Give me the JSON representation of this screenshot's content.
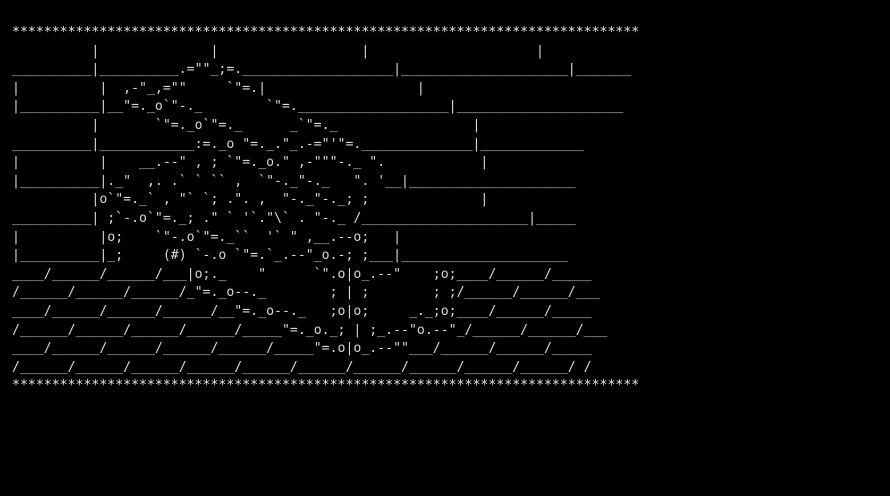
{
  "palette": {
    "background": "#000000",
    "art": "#ffffff",
    "wall_lines": "#e0c25a",
    "border": "#e8e8e8"
  },
  "ascii_art": {
    "top_border": "*******************************************************************************",
    "body": "          |              |                  |                     |\n__________|__________.=\"\"_;=.___________________|_____________________|_______\n|          |  ,-\"_,=\"\"     `\"=.|                   |\n|__________|__\"=._o`\"-._        `\"=.___________________|_____________________\n          |       `\"=._o`\"=._      _`\"=._                 |\n__________|____________:=._o \"=._.\"_.-=\"'\"=.______________|_____________\n|          |    __.--\" , ; `\"=._o.\" ,-\"\"\"-._ \".            |\n|__________|._\"  ,. .` ` `` ,  `\"-._\"-._   \". '__|_____________________\n          |o`\"=._` , \"` `; .\". ,  \"-._\"-._; ;              |\n__________| ;`-.o`\"=._; .\" ` '`.\"\\` . \"-._ /_____________________|_____\n|          |o;    `\"-.o`\"=._``  '` \" ,__.--o;   |\n|__________|_;     (#) `-.o `\"=.`_.--\"_o.-; ;___|_____________________\n____/______/______/___|o;._    \"      `\".o|o_.--\"    ;o;____/______/_____\n/______/______/______/_\"=._o--._        ; | ;        ; ;/______/______/___\n____/______/______/______/__\"=._o--._   ;o|o;     _._;o;____/______/_____\n/______/______/______/______/_____\"=._o._; | ;_.--\"o.--\"_/______/______/___\n____/______/______/______/______/_____\"=.o|o_.--\"\"___/______/______/_____\n/______/______/______/______/______/______/______/______/______/______/ /",
    "bottom_border": "*******************************************************************************"
  }
}
